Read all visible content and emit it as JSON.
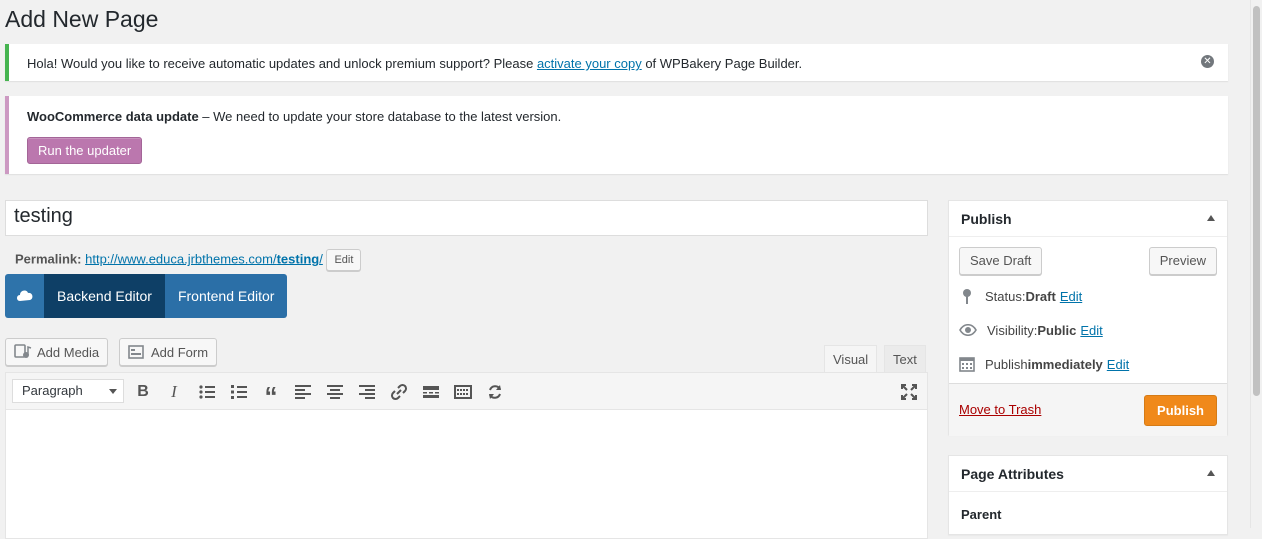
{
  "page": {
    "title": "Add New Page"
  },
  "notice_wpbakery": {
    "text_before": "Hola! Would you like to receive automatic updates and unlock premium support? Please ",
    "link_text": "activate your copy",
    "text_after": " of WPBakery Page Builder.",
    "dismiss_glyph": "✕"
  },
  "notice_woocommerce": {
    "bold": "WooCommerce data update",
    "text": " – We need to update your store database to the latest version.",
    "button_label": "Run the updater"
  },
  "post_title": {
    "value": "testing"
  },
  "permalink": {
    "label": "Permalink:",
    "url_prefix": "http://www.educa.jrbthemes.com/",
    "slug": "testing",
    "url_suffix": "/",
    "edit_label": "Edit"
  },
  "wpbakery": {
    "backend_label": "Backend Editor",
    "frontend_label": "Frontend Editor"
  },
  "media_buttons": {
    "add_media": "Add Media",
    "add_form": "Add Form"
  },
  "editor_tabs": {
    "visual": "Visual",
    "text": "Text"
  },
  "toolbar": {
    "format_value": "Paragraph",
    "icons": [
      "bold-icon",
      "italic-icon",
      "bullet-list-icon",
      "numbered-list-icon",
      "blockquote-icon",
      "align-left-icon",
      "align-center-icon",
      "align-right-icon",
      "link-icon",
      "read-more-icon",
      "toolbar-toggle-icon",
      "refresh-icon",
      "fullscreen-icon"
    ]
  },
  "publish_box": {
    "heading": "Publish",
    "save_draft": "Save Draft",
    "preview": "Preview",
    "status_label": "Status: ",
    "status_value": "Draft",
    "visibility_label": "Visibility: ",
    "visibility_value": "Public",
    "publish_label": "Publish ",
    "publish_value": "immediately",
    "edit_label": "Edit",
    "trash_label": "Move to Trash",
    "publish_button": "Publish"
  },
  "page_attributes": {
    "heading": "Page Attributes",
    "parent_label": "Parent"
  },
  "colors": {
    "success": "#46b450",
    "woo_purple": "#bb77ae",
    "wpb_dark": "#0e3f66",
    "wpb_blue": "#2b6fa7",
    "publish_orange": "#f0891a",
    "trash_red": "#a00"
  }
}
